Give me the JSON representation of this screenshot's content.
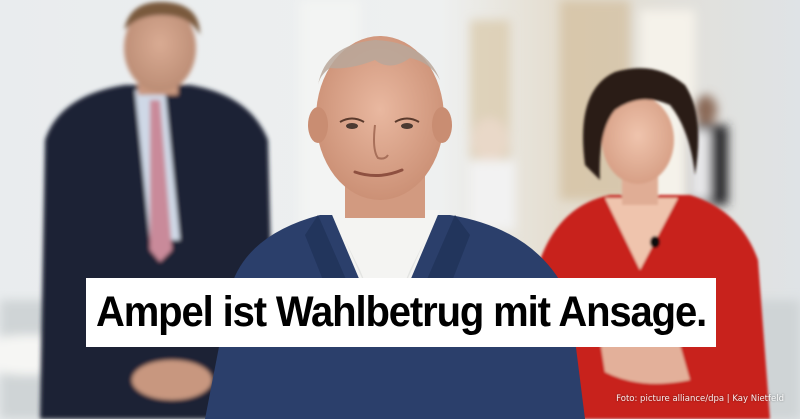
{
  "headline": {
    "text": "Ampel ist Wahlbetrug mit Ansage.",
    "background_color": "#ffffff",
    "text_color": "#000000"
  },
  "credit": {
    "text": "Foto: picture alliance/dpa  |  Kay Nietfeld"
  },
  "people": [
    {
      "id": "left-man",
      "suit_color": "#1c2336",
      "tie_color": "#c98a9a"
    },
    {
      "id": "center-man",
      "suit_color": "#2b3f6b",
      "shirt_color": "#f4f4f2"
    },
    {
      "id": "right-woman",
      "dress_color": "#c8201c",
      "hair_color": "#2a1a14"
    }
  ]
}
